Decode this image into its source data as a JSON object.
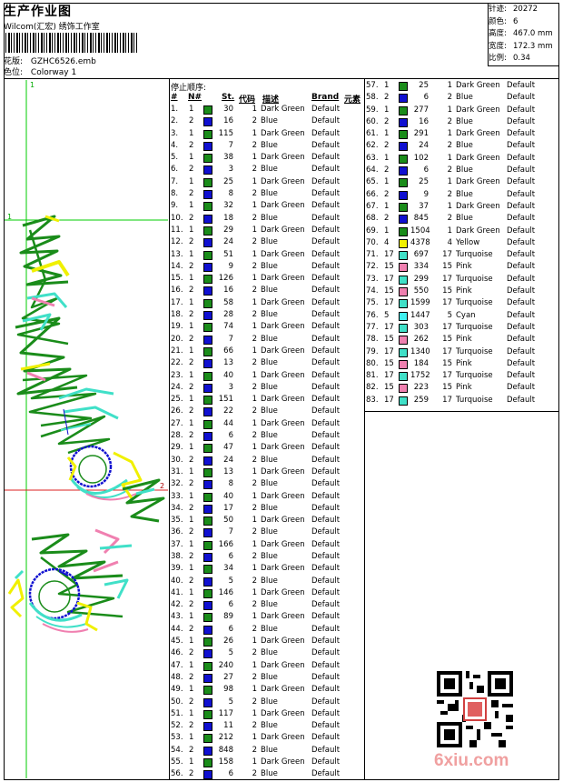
{
  "header": {
    "title": "生产作业图",
    "company": "Wilcom(汇宏) 绣饰工作室",
    "design_label": "花版:",
    "design_value": "GZHC6526.emb",
    "colorway_label": "色位:",
    "colorway_value": "Colorway 1"
  },
  "stats": [
    {
      "label": "针迹:",
      "value": "20272"
    },
    {
      "label": "颜色:",
      "value": "6"
    },
    {
      "label": "高度:",
      "value": "467.0 mm"
    },
    {
      "label": "宽度:",
      "value": "172.3 mm"
    },
    {
      "label": "比例:",
      "value": "0.34"
    }
  ],
  "preview": {
    "marker_top": "1",
    "marker_left": "1",
    "marker_right": "2"
  },
  "stop_list": {
    "title": "停止顺序:",
    "headers": {
      "idx": "#",
      "cd": "N#",
      "st": "St.",
      "code": "代码",
      "desc": "描述",
      "brand": "Brand",
      "element": "元素"
    }
  },
  "colors": {
    "1": "#1a8c1a",
    "2": "#1010d0",
    "4": "#f0f000",
    "15": "#f080b0",
    "17": "#40e0c8",
    "5": "#40f0f0"
  },
  "rows": [
    {
      "idx": "1.",
      "cd": "1",
      "st": "30",
      "cno": "1",
      "desc": "Dark Green",
      "brand": "Default"
    },
    {
      "idx": "2.",
      "cd": "2",
      "st": "16",
      "cno": "2",
      "desc": "Blue",
      "brand": "Default"
    },
    {
      "idx": "3.",
      "cd": "1",
      "st": "115",
      "cno": "1",
      "desc": "Dark Green",
      "brand": "Default"
    },
    {
      "idx": "4.",
      "cd": "2",
      "st": "7",
      "cno": "2",
      "desc": "Blue",
      "brand": "Default"
    },
    {
      "idx": "5.",
      "cd": "1",
      "st": "38",
      "cno": "1",
      "desc": "Dark Green",
      "brand": "Default"
    },
    {
      "idx": "6.",
      "cd": "2",
      "st": "3",
      "cno": "2",
      "desc": "Blue",
      "brand": "Default"
    },
    {
      "idx": "7.",
      "cd": "1",
      "st": "25",
      "cno": "1",
      "desc": "Dark Green",
      "brand": "Default"
    },
    {
      "idx": "8.",
      "cd": "2",
      "st": "8",
      "cno": "2",
      "desc": "Blue",
      "brand": "Default"
    },
    {
      "idx": "9.",
      "cd": "1",
      "st": "32",
      "cno": "1",
      "desc": "Dark Green",
      "brand": "Default"
    },
    {
      "idx": "10.",
      "cd": "2",
      "st": "18",
      "cno": "2",
      "desc": "Blue",
      "brand": "Default"
    },
    {
      "idx": "11.",
      "cd": "1",
      "st": "29",
      "cno": "1",
      "desc": "Dark Green",
      "brand": "Default"
    },
    {
      "idx": "12.",
      "cd": "2",
      "st": "24",
      "cno": "2",
      "desc": "Blue",
      "brand": "Default"
    },
    {
      "idx": "13.",
      "cd": "1",
      "st": "51",
      "cno": "1",
      "desc": "Dark Green",
      "brand": "Default"
    },
    {
      "idx": "14.",
      "cd": "2",
      "st": "9",
      "cno": "2",
      "desc": "Blue",
      "brand": "Default"
    },
    {
      "idx": "15.",
      "cd": "1",
      "st": "126",
      "cno": "1",
      "desc": "Dark Green",
      "brand": "Default"
    },
    {
      "idx": "16.",
      "cd": "2",
      "st": "16",
      "cno": "2",
      "desc": "Blue",
      "brand": "Default"
    },
    {
      "idx": "17.",
      "cd": "1",
      "st": "58",
      "cno": "1",
      "desc": "Dark Green",
      "brand": "Default"
    },
    {
      "idx": "18.",
      "cd": "2",
      "st": "28",
      "cno": "2",
      "desc": "Blue",
      "brand": "Default"
    },
    {
      "idx": "19.",
      "cd": "1",
      "st": "74",
      "cno": "1",
      "desc": "Dark Green",
      "brand": "Default"
    },
    {
      "idx": "20.",
      "cd": "2",
      "st": "7",
      "cno": "2",
      "desc": "Blue",
      "brand": "Default"
    },
    {
      "idx": "21.",
      "cd": "1",
      "st": "66",
      "cno": "1",
      "desc": "Dark Green",
      "brand": "Default"
    },
    {
      "idx": "22.",
      "cd": "2",
      "st": "13",
      "cno": "2",
      "desc": "Blue",
      "brand": "Default"
    },
    {
      "idx": "23.",
      "cd": "1",
      "st": "40",
      "cno": "1",
      "desc": "Dark Green",
      "brand": "Default"
    },
    {
      "idx": "24.",
      "cd": "2",
      "st": "3",
      "cno": "2",
      "desc": "Blue",
      "brand": "Default"
    },
    {
      "idx": "25.",
      "cd": "1",
      "st": "151",
      "cno": "1",
      "desc": "Dark Green",
      "brand": "Default"
    },
    {
      "idx": "26.",
      "cd": "2",
      "st": "22",
      "cno": "2",
      "desc": "Blue",
      "brand": "Default"
    },
    {
      "idx": "27.",
      "cd": "1",
      "st": "44",
      "cno": "1",
      "desc": "Dark Green",
      "brand": "Default"
    },
    {
      "idx": "28.",
      "cd": "2",
      "st": "6",
      "cno": "2",
      "desc": "Blue",
      "brand": "Default"
    },
    {
      "idx": "29.",
      "cd": "1",
      "st": "47",
      "cno": "1",
      "desc": "Dark Green",
      "brand": "Default"
    },
    {
      "idx": "30.",
      "cd": "2",
      "st": "24",
      "cno": "2",
      "desc": "Blue",
      "brand": "Default"
    },
    {
      "idx": "31.",
      "cd": "1",
      "st": "13",
      "cno": "1",
      "desc": "Dark Green",
      "brand": "Default"
    },
    {
      "idx": "32.",
      "cd": "2",
      "st": "8",
      "cno": "2",
      "desc": "Blue",
      "brand": "Default"
    },
    {
      "idx": "33.",
      "cd": "1",
      "st": "40",
      "cno": "1",
      "desc": "Dark Green",
      "brand": "Default"
    },
    {
      "idx": "34.",
      "cd": "2",
      "st": "17",
      "cno": "2",
      "desc": "Blue",
      "brand": "Default"
    },
    {
      "idx": "35.",
      "cd": "1",
      "st": "50",
      "cno": "1",
      "desc": "Dark Green",
      "brand": "Default"
    },
    {
      "idx": "36.",
      "cd": "2",
      "st": "7",
      "cno": "2",
      "desc": "Blue",
      "brand": "Default"
    },
    {
      "idx": "37.",
      "cd": "1",
      "st": "166",
      "cno": "1",
      "desc": "Dark Green",
      "brand": "Default"
    },
    {
      "idx": "38.",
      "cd": "2",
      "st": "6",
      "cno": "2",
      "desc": "Blue",
      "brand": "Default"
    },
    {
      "idx": "39.",
      "cd": "1",
      "st": "34",
      "cno": "1",
      "desc": "Dark Green",
      "brand": "Default"
    },
    {
      "idx": "40.",
      "cd": "2",
      "st": "5",
      "cno": "2",
      "desc": "Blue",
      "brand": "Default"
    },
    {
      "idx": "41.",
      "cd": "1",
      "st": "146",
      "cno": "1",
      "desc": "Dark Green",
      "brand": "Default"
    },
    {
      "idx": "42.",
      "cd": "2",
      "st": "6",
      "cno": "2",
      "desc": "Blue",
      "brand": "Default"
    },
    {
      "idx": "43.",
      "cd": "1",
      "st": "89",
      "cno": "1",
      "desc": "Dark Green",
      "brand": "Default"
    },
    {
      "idx": "44.",
      "cd": "2",
      "st": "6",
      "cno": "2",
      "desc": "Blue",
      "brand": "Default"
    },
    {
      "idx": "45.",
      "cd": "1",
      "st": "26",
      "cno": "1",
      "desc": "Dark Green",
      "brand": "Default"
    },
    {
      "idx": "46.",
      "cd": "2",
      "st": "5",
      "cno": "2",
      "desc": "Blue",
      "brand": "Default"
    },
    {
      "idx": "47.",
      "cd": "1",
      "st": "240",
      "cno": "1",
      "desc": "Dark Green",
      "brand": "Default"
    },
    {
      "idx": "48.",
      "cd": "2",
      "st": "27",
      "cno": "2",
      "desc": "Blue",
      "brand": "Default"
    },
    {
      "idx": "49.",
      "cd": "1",
      "st": "98",
      "cno": "1",
      "desc": "Dark Green",
      "brand": "Default"
    },
    {
      "idx": "50.",
      "cd": "2",
      "st": "5",
      "cno": "2",
      "desc": "Blue",
      "brand": "Default"
    },
    {
      "idx": "51.",
      "cd": "1",
      "st": "117",
      "cno": "1",
      "desc": "Dark Green",
      "brand": "Default"
    },
    {
      "idx": "52.",
      "cd": "2",
      "st": "11",
      "cno": "2",
      "desc": "Blue",
      "brand": "Default"
    },
    {
      "idx": "53.",
      "cd": "1",
      "st": "212",
      "cno": "1",
      "desc": "Dark Green",
      "brand": "Default"
    },
    {
      "idx": "54.",
      "cd": "2",
      "st": "848",
      "cno": "2",
      "desc": "Blue",
      "brand": "Default"
    },
    {
      "idx": "55.",
      "cd": "1",
      "st": "158",
      "cno": "1",
      "desc": "Dark Green",
      "brand": "Default"
    },
    {
      "idx": "56.",
      "cd": "2",
      "st": "6",
      "cno": "2",
      "desc": "Blue",
      "brand": "Default"
    },
    {
      "idx": "57.",
      "cd": "1",
      "st": "25",
      "cno": "1",
      "desc": "Dark Green",
      "brand": "Default"
    },
    {
      "idx": "58.",
      "cd": "2",
      "st": "6",
      "cno": "2",
      "desc": "Blue",
      "brand": "Default"
    },
    {
      "idx": "59.",
      "cd": "1",
      "st": "277",
      "cno": "1",
      "desc": "Dark Green",
      "brand": "Default"
    },
    {
      "idx": "60.",
      "cd": "2",
      "st": "16",
      "cno": "2",
      "desc": "Blue",
      "brand": "Default"
    },
    {
      "idx": "61.",
      "cd": "1",
      "st": "291",
      "cno": "1",
      "desc": "Dark Green",
      "brand": "Default"
    },
    {
      "idx": "62.",
      "cd": "2",
      "st": "24",
      "cno": "2",
      "desc": "Blue",
      "brand": "Default"
    },
    {
      "idx": "63.",
      "cd": "1",
      "st": "102",
      "cno": "1",
      "desc": "Dark Green",
      "brand": "Default"
    },
    {
      "idx": "64.",
      "cd": "2",
      "st": "6",
      "cno": "2",
      "desc": "Blue",
      "brand": "Default"
    },
    {
      "idx": "65.",
      "cd": "1",
      "st": "25",
      "cno": "1",
      "desc": "Dark Green",
      "brand": "Default"
    },
    {
      "idx": "66.",
      "cd": "2",
      "st": "9",
      "cno": "2",
      "desc": "Blue",
      "brand": "Default"
    },
    {
      "idx": "67.",
      "cd": "1",
      "st": "37",
      "cno": "1",
      "desc": "Dark Green",
      "brand": "Default"
    },
    {
      "idx": "68.",
      "cd": "2",
      "st": "845",
      "cno": "2",
      "desc": "Blue",
      "brand": "Default"
    },
    {
      "idx": "69.",
      "cd": "1",
      "st": "1504",
      "cno": "1",
      "desc": "Dark Green",
      "brand": "Default"
    },
    {
      "idx": "70.",
      "cd": "4",
      "st": "4378",
      "cno": "4",
      "desc": "Yellow",
      "brand": "Default"
    },
    {
      "idx": "71.",
      "cd": "17",
      "st": "697",
      "cno": "17",
      "desc": "Turquoise",
      "brand": "Default"
    },
    {
      "idx": "72.",
      "cd": "15",
      "st": "334",
      "cno": "15",
      "desc": "Pink",
      "brand": "Default"
    },
    {
      "idx": "73.",
      "cd": "17",
      "st": "299",
      "cno": "17",
      "desc": "Turquoise",
      "brand": "Default"
    },
    {
      "idx": "74.",
      "cd": "15",
      "st": "550",
      "cno": "15",
      "desc": "Pink",
      "brand": "Default"
    },
    {
      "idx": "75.",
      "cd": "17",
      "st": "1599",
      "cno": "17",
      "desc": "Turquoise",
      "brand": "Default"
    },
    {
      "idx": "76.",
      "cd": "5",
      "st": "1447",
      "cno": "5",
      "desc": "Cyan",
      "brand": "Default"
    },
    {
      "idx": "77.",
      "cd": "17",
      "st": "303",
      "cno": "17",
      "desc": "Turquoise",
      "brand": "Default"
    },
    {
      "idx": "78.",
      "cd": "15",
      "st": "262",
      "cno": "15",
      "desc": "Pink",
      "brand": "Default"
    },
    {
      "idx": "79.",
      "cd": "17",
      "st": "1340",
      "cno": "17",
      "desc": "Turquoise",
      "brand": "Default"
    },
    {
      "idx": "80.",
      "cd": "15",
      "st": "184",
      "cno": "15",
      "desc": "Pink",
      "brand": "Default"
    },
    {
      "idx": "81.",
      "cd": "17",
      "st": "1752",
      "cno": "17",
      "desc": "Turquoise",
      "brand": "Default"
    },
    {
      "idx": "82.",
      "cd": "15",
      "st": "223",
      "cno": "15",
      "desc": "Pink",
      "brand": "Default"
    },
    {
      "idx": "83.",
      "cd": "17",
      "st": "259",
      "cno": "17",
      "desc": "Turquoise",
      "brand": "Default"
    }
  ],
  "watermark": {
    "site": "6xiu.com",
    "seal_icon": "seal-stamp-icon",
    "qr_icon": "qr-code-icon"
  }
}
